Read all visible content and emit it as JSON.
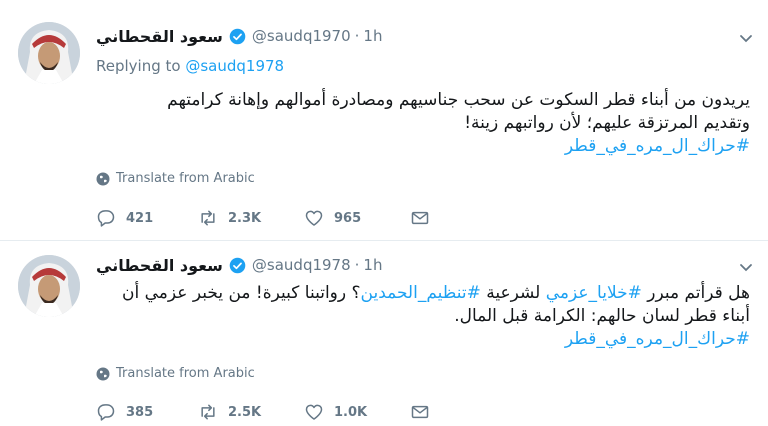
{
  "colors": {
    "link": "#1da1f2",
    "muted": "#657786",
    "text": "#14171a",
    "divider": "#e6ecf0"
  },
  "tweets": [
    {
      "name": "سعود القحطاني",
      "handle": "@saudq1970",
      "separator": "·",
      "time": "1h",
      "replying_prefix": "Replying to",
      "replying_to": "@saudq1978",
      "lines": [
        "يريدون من أبناء قطر السكوت عن سحب جناسيهم ومصادرة أموالهم وإهانة كرامتهم",
        "وتقديم المرتزقة عليهم؛ لأن رواتبهم زينة!"
      ],
      "hashtag": "#حراك_ال_مره_في_قطر",
      "translate": "Translate from Arabic",
      "replies": "421",
      "retweets": "2.3K",
      "likes": "965",
      "icons": [
        "reply-icon",
        "retweet-icon",
        "like-icon",
        "message-icon"
      ]
    },
    {
      "name": "سعود القحطاني",
      "handle": "@saudq1978",
      "separator": "·",
      "time": "1h",
      "line1_start": "هل قرأتم مبرر ",
      "line1_tag1": "#خلايا_عزمي",
      "line1_mid": " لشرعية ",
      "line1_tag2": "#تنظيم_الحمدين",
      "line1_end": "؟ رواتبنا كبيرة! من يخبر عزمي أن",
      "line2": "أبناء قطر لسان حالهم: الكرامة قبل المال.",
      "hashtag": "#حراك_ال_مره_في_قطر",
      "translate": "Translate from Arabic",
      "replies": "385",
      "retweets": "2.5K",
      "likes": "1.0K",
      "icons": [
        "reply-icon",
        "retweet-icon",
        "like-icon",
        "message-icon"
      ]
    }
  ]
}
